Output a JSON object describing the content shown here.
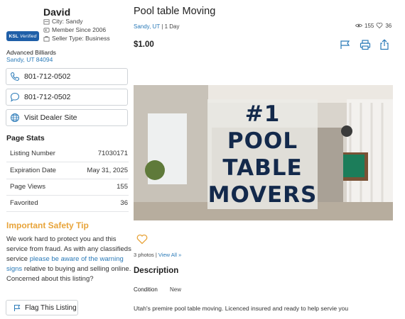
{
  "seller": {
    "name": "David",
    "badge": {
      "brand": "KSL",
      "text": "Verified"
    },
    "city": "City: Sandy",
    "member_since": "Member Since 2006",
    "seller_type": "Seller Type: Business",
    "business_name": "Advanced Billiards",
    "business_location": "Sandy, UT 84094"
  },
  "contact": {
    "phone_call": "801-712-0502",
    "phone_text": "801-712-0502",
    "dealer_site": "Visit Dealer Site"
  },
  "page_stats": {
    "title": "Page Stats",
    "rows": [
      {
        "label": "Listing Number",
        "value": "71030171"
      },
      {
        "label": "Expiration Date",
        "value": "May 31, 2025"
      },
      {
        "label": "Page Views",
        "value": "155"
      },
      {
        "label": "Favorited",
        "value": "36"
      }
    ]
  },
  "safety": {
    "title": "Important Safety Tip",
    "text_before": "We work hard to protect you and this service from fraud. As with any classifieds service ",
    "link": "please be aware of the warning signs",
    "text_after": " relative to buying and selling online. Concerned about this listing?",
    "flag_button": "Flag This Listing"
  },
  "listing": {
    "title": "Pool table Moving",
    "location": "Sandy, UT",
    "age": "| 1 Day",
    "views": "155",
    "favorites": "36",
    "price": "$1.00",
    "photo_banner": [
      "#1",
      "POOL",
      "TABLE",
      "MOVERS"
    ],
    "photo_count": "3 photos",
    "view_all": "View All »",
    "description_title": "Description",
    "condition_label": "Condition",
    "condition_value": "New",
    "description": "Utah's premire pool table moving. Licenced insured and ready to help servie you"
  },
  "icons": [
    "verified-badge",
    "location-icon",
    "member-icon",
    "seller-type-icon",
    "phone-icon",
    "chat-icon",
    "globe-icon",
    "flag-icon",
    "eye-icon",
    "heart-icon",
    "print-icon",
    "share-icon"
  ],
  "colors": {
    "link": "#2a7ab8",
    "safety_title": "#e8a43a",
    "badge": "#1f5fa8",
    "banner_text": "#13294b"
  }
}
